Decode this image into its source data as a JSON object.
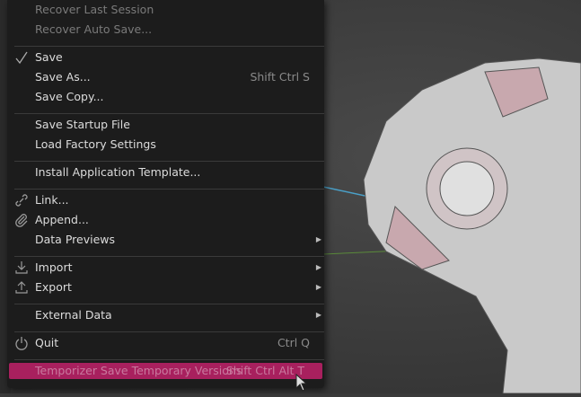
{
  "menu": {
    "recover_last": "Recover Last Session",
    "recover_auto": "Recover Auto Save...",
    "save": "Save",
    "save_as": "Save As...",
    "save_as_shortcut": "Shift Ctrl S",
    "save_copy": "Save Copy...",
    "save_startup": "Save Startup File",
    "load_factory": "Load Factory Settings",
    "install_template": "Install Application Template...",
    "link": "Link...",
    "append": "Append...",
    "data_previews": "Data Previews",
    "import": "Import",
    "export": "Export",
    "external_data": "External Data",
    "quit": "Quit",
    "quit_shortcut": "Ctrl Q",
    "temporizer": "Temporizer Save Temporary Versions",
    "temporizer_shortcut": "Shift Ctrl Alt T"
  },
  "colors": {
    "highlight": "#a8205e",
    "menu_bg": "#1c1c1c"
  }
}
